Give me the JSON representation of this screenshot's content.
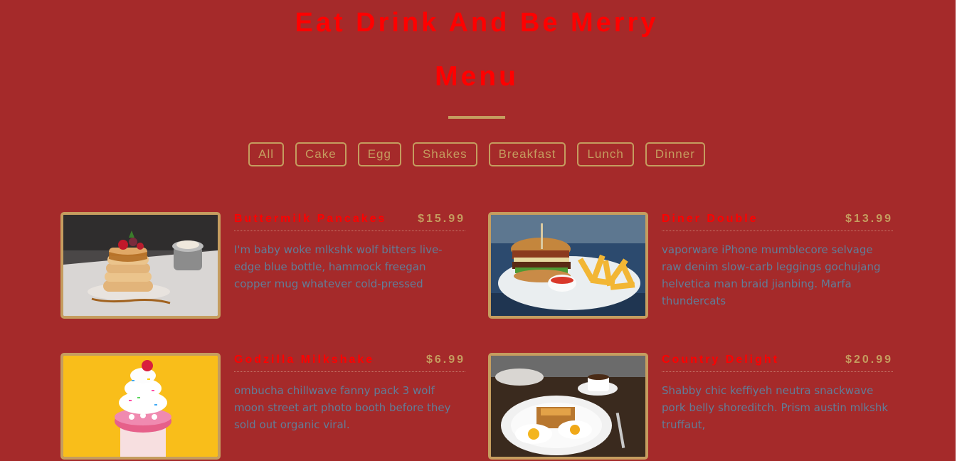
{
  "header": {
    "site_title": "Eat Drink And Be Merry",
    "menu_title": "Menu"
  },
  "filters": [
    "All",
    "Cake",
    "Egg",
    "Shakes",
    "Breakfast",
    "Lunch",
    "Dinner"
  ],
  "items": [
    {
      "name": "Buttermilk Pancakes",
      "price": "$15.99",
      "desc": "I'm baby woke mlkshk wolf bitters live-edge blue bottle, hammock freegan copper mug whatever cold-pressed",
      "image": "pancakes-photo"
    },
    {
      "name": "Diner Double",
      "price": "$13.99",
      "desc": "vaporware iPhone mumblecore selvage raw denim slow-carb leggings gochujang helvetica man braid jianbing. Marfa thundercats",
      "image": "burger-photo"
    },
    {
      "name": "Godzilla Milkshake",
      "price": "$6.99",
      "desc": "ombucha chillwave fanny pack 3 wolf moon street art photo booth before they sold out organic viral.",
      "image": "milkshake-photo"
    },
    {
      "name": "Country Delight",
      "price": "$20.99",
      "desc": "Shabby chic keffiyeh neutra snackwave pork belly shoreditch. Prism austin mlkshk truffaut,",
      "image": "breakfast-photo"
    }
  ],
  "colors": {
    "background": "#a52a2a",
    "title": "#ff0000",
    "accent": "#c59d5f",
    "description": "#617d98"
  }
}
